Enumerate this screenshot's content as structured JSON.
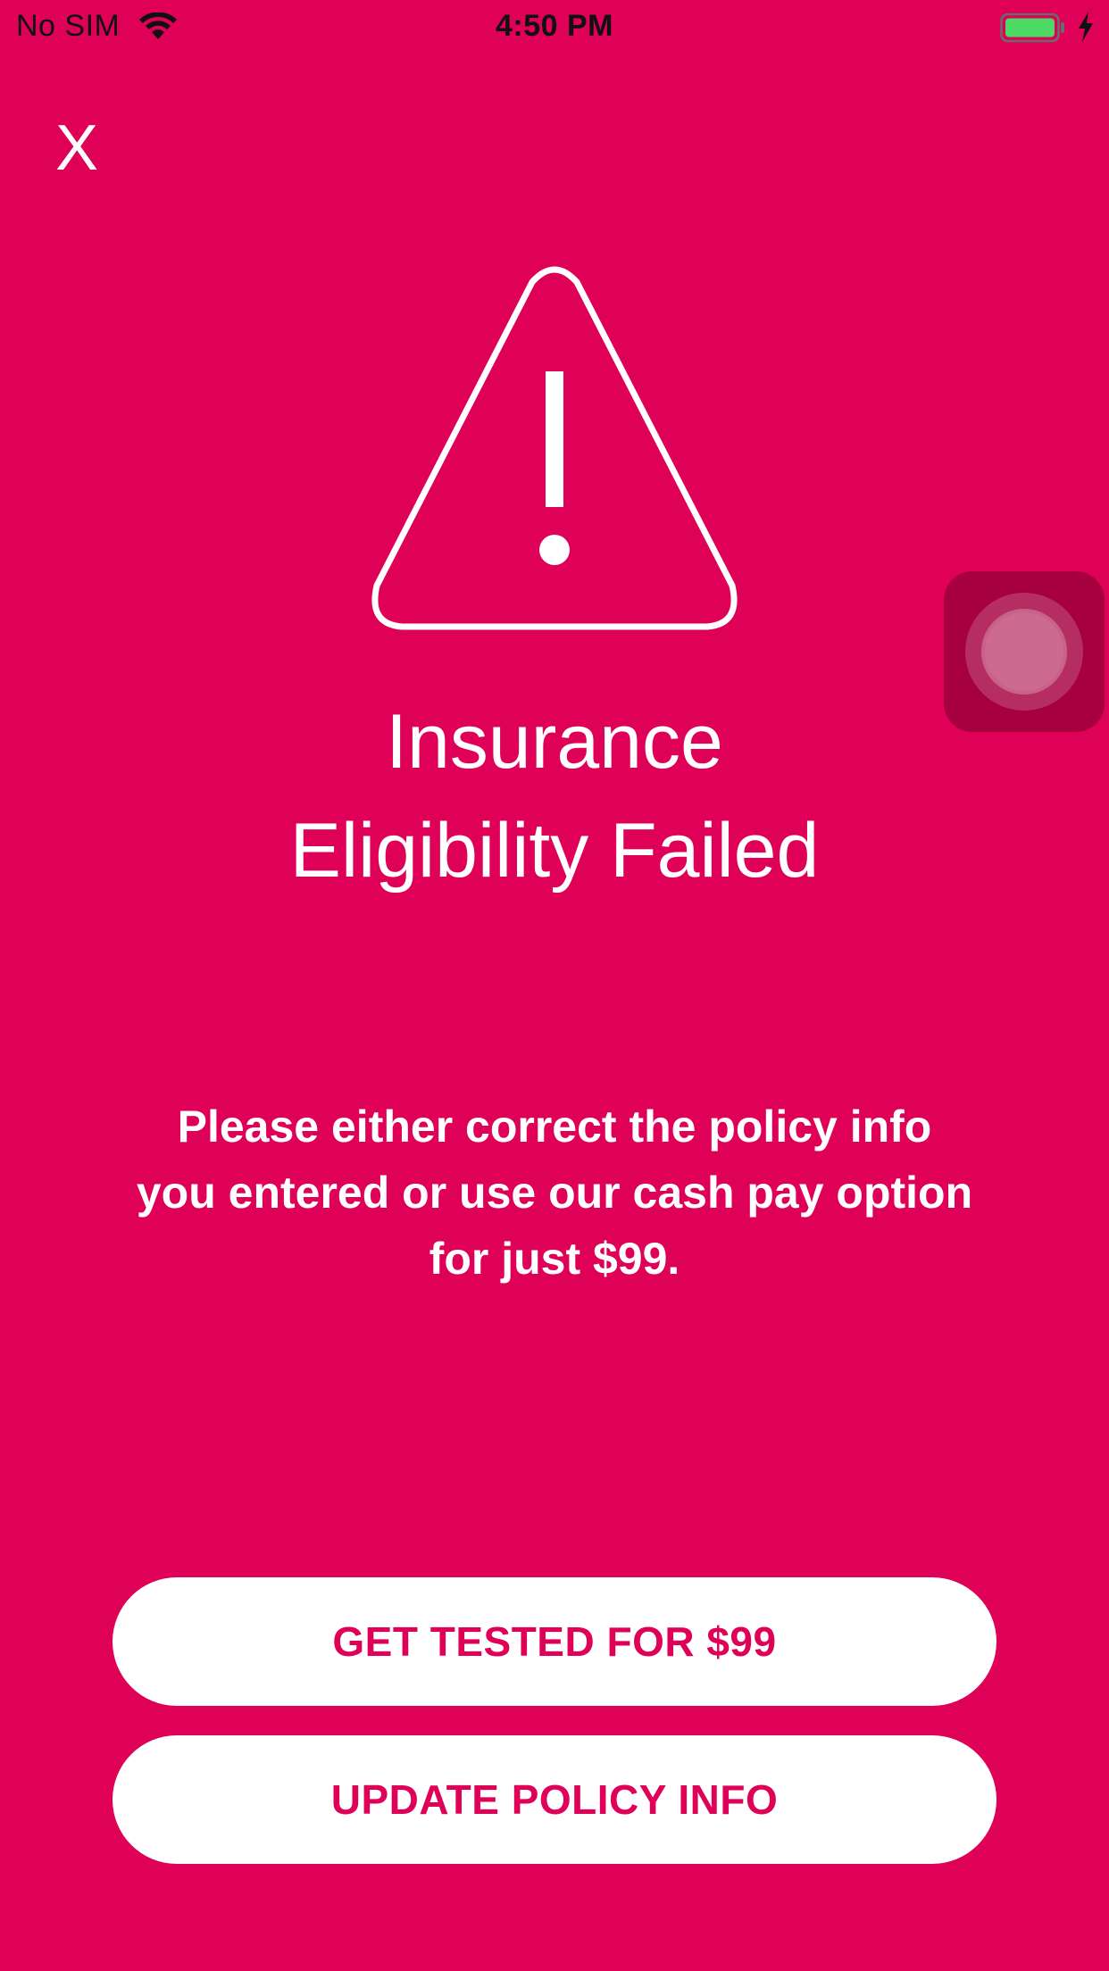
{
  "status_bar": {
    "carrier": "No SIM",
    "time": "4:50 PM",
    "battery_color": "#4CD964",
    "wifi_icon": "wifi-icon",
    "battery_icon": "battery-icon",
    "charging_icon": "charging-bolt-icon"
  },
  "header": {
    "close_label": "X"
  },
  "alert": {
    "icon": "warning-triangle-icon",
    "title_line1": "Insurance",
    "title_line2": "Eligibility Failed",
    "description": "Please either correct the policy info you entered or use our cash pay option for just $99."
  },
  "actions": {
    "primary_label": "GET TESTED FOR $99",
    "secondary_label": "UPDATE POLICY INFO"
  },
  "colors": {
    "background": "#DF0057",
    "button_text": "#DF0057",
    "button_bg": "#FFFFFF"
  }
}
